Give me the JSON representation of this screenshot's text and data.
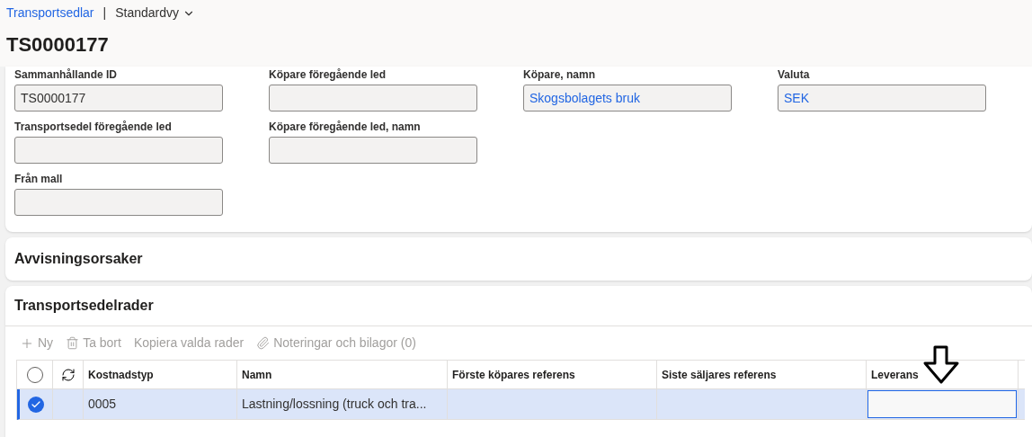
{
  "breadcrumb": {
    "link": "Transportsedlar",
    "separator": "|",
    "view": "Standardvy"
  },
  "title": "TS0000177",
  "field_columns": [
    [
      {
        "label": "Sammanhållande ID",
        "value": "TS0000177",
        "link": false
      },
      {
        "label": "Transportsedel föregående led"
      },
      {
        "label": "Från mall"
      }
    ],
    [
      {
        "label": "Köpare föregående led"
      },
      {
        "label": "Köpare föregående led, namn"
      }
    ],
    [
      {
        "label": "Köpare, namn",
        "value": "Skogsbolagets bruk",
        "link": true
      }
    ],
    [
      {
        "label": "Valuta",
        "value": "SEK",
        "link": true
      }
    ]
  ],
  "rejection_section": {
    "title": "Avvisningsorsaker"
  },
  "lines_section": {
    "title": "Transportsedelrader",
    "toolbar": [
      {
        "kind": "new",
        "label": "Ny",
        "disabled": true
      },
      {
        "kind": "delete",
        "label": "Ta bort",
        "disabled": true
      },
      {
        "kind": "plain",
        "label": "Kopiera valda rader",
        "disabled": true
      },
      {
        "kind": "attach",
        "label": "Noteringar och bilagor (0)",
        "disabled": true
      }
    ],
    "all_selected": false,
    "columns": [
      "Kostnadstyp",
      "Namn",
      "Förste köpares referens",
      "Siste säljares referens",
      "Leverans"
    ],
    "rows": [
      {
        "selected": true,
        "cells": [
          {
            "kind": "text",
            "text": "0005"
          },
          {
            "kind": "text",
            "text": "Lastning/lossning (truck och tra..."
          },
          {
            "kind": "empty"
          },
          {
            "kind": "empty"
          },
          {
            "kind": "input"
          }
        ]
      }
    ]
  }
}
